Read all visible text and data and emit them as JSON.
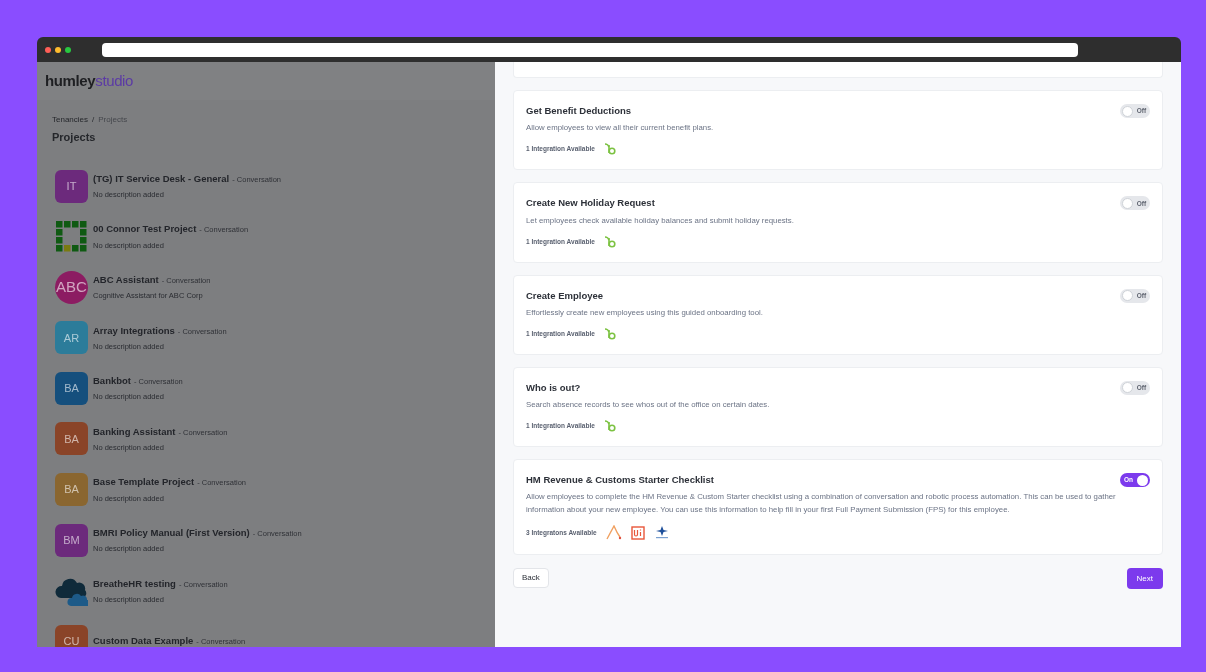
{
  "brand": {
    "first": "humley",
    "second": "studio"
  },
  "breadcrumb": [
    {
      "label": "Tenancies"
    },
    {
      "label": "Projects"
    }
  ],
  "breadcrumb_separator": "/",
  "page_title": "Projects",
  "projects": [
    {
      "name": "(TG) IT Service Desk - General",
      "type": "- Conversation",
      "description": "No description added",
      "avatar": {
        "kind": "square",
        "text": "IT",
        "color": "#6c2a7c"
      }
    },
    {
      "name": "00 Connor Test Project",
      "type": "- Conversation",
      "description": "No description added",
      "avatar": {
        "kind": "grid"
      }
    },
    {
      "name": "ABC Assistant",
      "type": "- Conversation",
      "description": "Cognitive Assistant for ABC Corp",
      "avatar": {
        "kind": "circle",
        "text": "ABC",
        "color": "#8c1c62"
      }
    },
    {
      "name": "Array Integrations",
      "type": "- Conversation",
      "description": "No description added",
      "avatar": {
        "kind": "square",
        "text": "AR",
        "color": "#2c7c9a"
      }
    },
    {
      "name": "Bankbot",
      "type": "- Conversation",
      "description": "No description added",
      "avatar": {
        "kind": "square",
        "text": "BA",
        "color": "#154f7d"
      }
    },
    {
      "name": "Banking Assistant",
      "type": "- Conversation",
      "description": "No description added",
      "avatar": {
        "kind": "square",
        "text": "BA",
        "color": "#8a4428"
      }
    },
    {
      "name": "Base Template Project",
      "type": "- Conversation",
      "description": "No description added",
      "avatar": {
        "kind": "square",
        "text": "BA",
        "color": "#8a6630"
      }
    },
    {
      "name": "BMRI Policy Manual (First Version)",
      "type": "- Conversation",
      "description": "No description added",
      "avatar": {
        "kind": "square",
        "text": "BM",
        "color": "#6c2a7c"
      }
    },
    {
      "name": "BreatheHR testing",
      "type": "- Conversation",
      "description": "No description added",
      "avatar": {
        "kind": "cloud"
      }
    },
    {
      "name": "Custom Data Example",
      "type": "- Conversation",
      "avatar": {
        "kind": "square",
        "text": "CU",
        "color": "#8a4428"
      }
    }
  ],
  "features": [
    {
      "title": "Get Benefit Deductions",
      "description": "Allow employees to view all their current benefit plans.",
      "integrations": "1 Integration Available",
      "logos": [
        {
          "kind": "leaf-b"
        }
      ],
      "on": false,
      "toggle_label": "Off"
    },
    {
      "title": "Create New Holiday Request",
      "description": "Let employees check available holiday balances and submit holiday requests.",
      "integrations": "1 Integration Available",
      "logos": [
        {
          "kind": "leaf-b"
        }
      ],
      "on": false,
      "toggle_label": "Off"
    },
    {
      "title": "Create Employee",
      "description": "Effortlessly create new employees using this guided onboarding tool.",
      "integrations": "1 Integration Available",
      "logos": [
        {
          "kind": "leaf-b"
        }
      ],
      "on": false,
      "toggle_label": "Off"
    },
    {
      "title": "Who is out?",
      "description": "Search absence records to see whos out of the office on certain dates.",
      "integrations": "1 Integration Available",
      "logos": [
        {
          "kind": "leaf-b"
        }
      ],
      "on": false,
      "toggle_label": "Off"
    },
    {
      "title": "HM Revenue & Customs Starter Checklist",
      "description": "Allow employees to complete the HM Revenue & Custom Starter checklist using a combination of conversation and robotic process automation. This can be used to gather information about your new employee. You can use this information to help fill in your first Full Payment Submission (FPS) for this employee.",
      "integrations": "3 Integratons Available",
      "logos": [
        {
          "kind": "a-curve"
        },
        {
          "kind": "ui-box"
        },
        {
          "kind": "star"
        }
      ],
      "on": true,
      "toggle_label": "On"
    }
  ],
  "buttons": {
    "back": "Back",
    "next": "Next"
  }
}
